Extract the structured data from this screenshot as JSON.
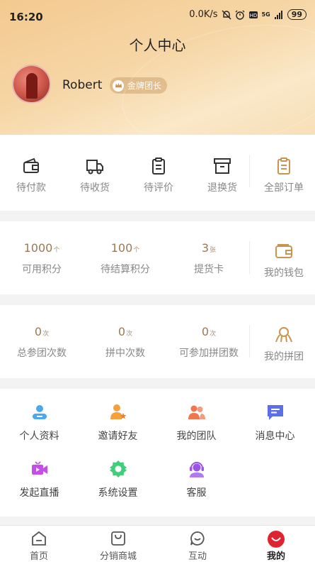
{
  "status_bar": {
    "time": "16:20",
    "speed": "0.0K/s",
    "battery": "99",
    "network": "5G"
  },
  "header": {
    "title": "个人中心",
    "username": "Robert",
    "badge": "金牌团长"
  },
  "orders": {
    "items": [
      {
        "label": "待付款",
        "icon": "wallet-icon"
      },
      {
        "label": "待收货",
        "icon": "truck-icon"
      },
      {
        "label": "待评价",
        "icon": "clipboard-icon"
      },
      {
        "label": "退换货",
        "icon": "archive-box-icon"
      }
    ],
    "all": {
      "label": "全部订单",
      "icon": "clipboard-gold-icon"
    }
  },
  "assets": {
    "items": [
      {
        "value": "1000",
        "unit": "个",
        "label": "可用积分"
      },
      {
        "value": "100",
        "unit": "个",
        "label": "待结算积分"
      },
      {
        "value": "3",
        "unit": "张",
        "label": "提货卡"
      }
    ],
    "wallet": {
      "label": "我的钱包",
      "icon": "wallet-gold-icon"
    }
  },
  "group": {
    "items": [
      {
        "value": "0",
        "unit": "次",
        "label": "总参团次数"
      },
      {
        "value": "0",
        "unit": "次",
        "label": "拼中次数"
      },
      {
        "value": "0",
        "unit": "次",
        "label": "可参加拼团数"
      }
    ],
    "mine": {
      "label": "我的拼团",
      "icon": "group-gold-icon"
    }
  },
  "services": [
    {
      "label": "个人资料",
      "icon": "profile-icon",
      "color": "#4aa8ee"
    },
    {
      "label": "邀请好友",
      "icon": "invite-icon",
      "color": "#f5a03c"
    },
    {
      "label": "我的团队",
      "icon": "team-icon",
      "color": "#f0764e"
    },
    {
      "label": "消息中心",
      "icon": "message-icon",
      "color": "#5a6fe8"
    },
    {
      "label": "发起直播",
      "icon": "live-icon",
      "color": "#c44ee8"
    },
    {
      "label": "系统设置",
      "icon": "settings-icon",
      "color": "#3fcf7a"
    },
    {
      "label": "客服",
      "icon": "customer-service-icon",
      "color": "#9a55e8"
    }
  ],
  "tabs": [
    {
      "label": "首页",
      "icon": "home-icon"
    },
    {
      "label": "分销商城",
      "icon": "shopping-bag-icon"
    },
    {
      "label": "互动",
      "icon": "chat-icon"
    },
    {
      "label": "我的",
      "icon": "me-icon",
      "active": true
    }
  ],
  "colors": {
    "gold": "#c9944f",
    "brand_red": "#e0242f",
    "header_start": "#f3c98f"
  }
}
